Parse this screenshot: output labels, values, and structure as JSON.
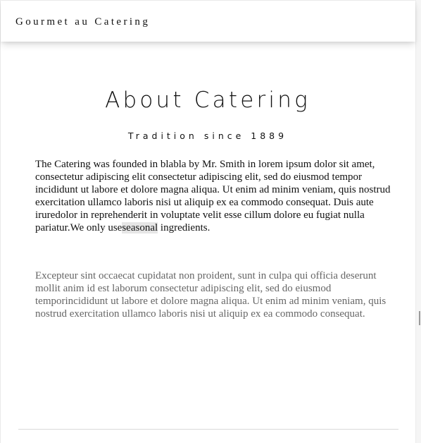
{
  "nav": {
    "brand": "Gourmet au Catering"
  },
  "about": {
    "title": "About Catering",
    "subtitle": "Tradition since 1889",
    "paragraph_1_prefix": "The Catering was founded in blabla by Mr. Smith in lorem ipsum dolor sit amet, consectetur adipiscing elit consectetur adipiscing elit, sed do eiusmod tempor incididunt ut labore et dolore magna aliqua. Ut enim ad minim veniam, quis nostrud exercitation ullamco laboris nisi ut aliquip ex ea commodo consequat. Duis aute iruredolor in reprehenderit in voluptate velit esse cillum dolore eu fugiat nulla pariatur.We only use",
    "paragraph_1_highlight": "seasonal",
    "paragraph_1_suffix": " ingredients.",
    "paragraph_2": "Excepteur sint occaecat cupidatat non proident, sunt in culpa qui officia deserunt mollit anim id est laborum consectetur adipiscing elit, sed do eiusmod temporincididunt ut labore et dolore magna aliqua. Ut enim ad minim veniam, quis nostrud exercitation ullamco laboris nisi ut aliquip ex ea commodo consequat."
  },
  "colors": {
    "text": "#111111",
    "muted_text": "#666666",
    "highlight": "#e6e6e6",
    "background": "#ffffff"
  }
}
